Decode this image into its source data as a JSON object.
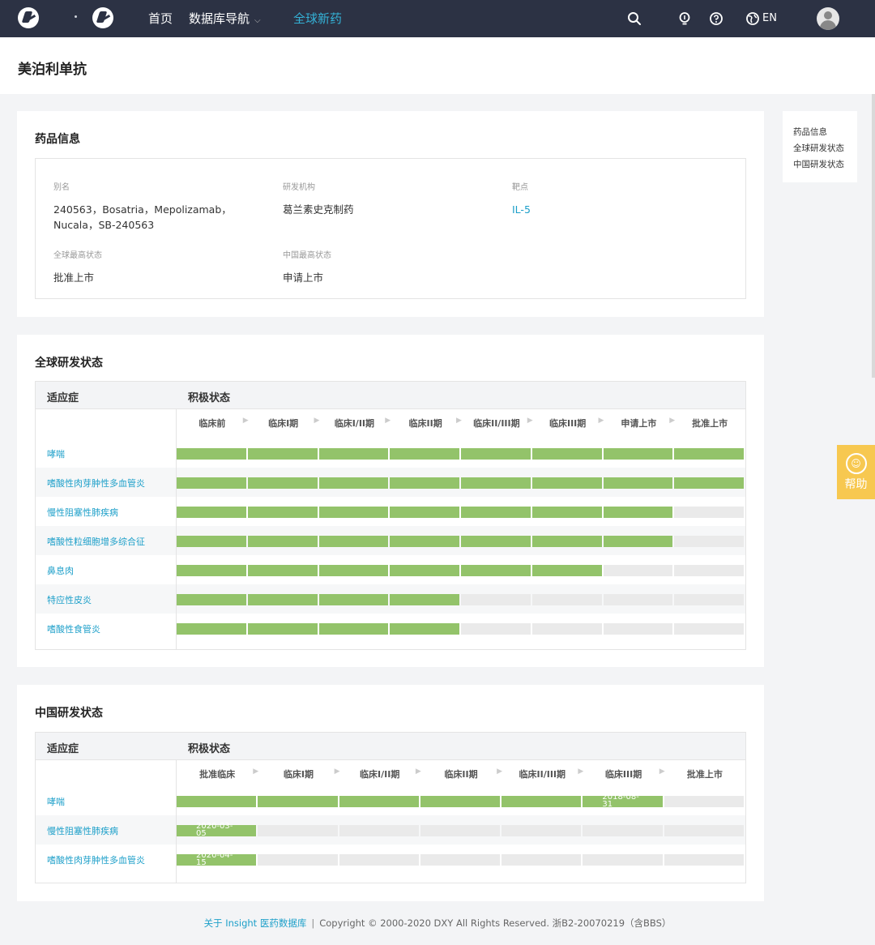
{
  "nav": {
    "home": "首页",
    "db_nav": "数据库导航",
    "global_new_drugs": "全球新药",
    "lang": "EN"
  },
  "page": {
    "title": "美泊利单抗"
  },
  "drug_info": {
    "title": "药品信息",
    "alias_label": "别名",
    "alias_value": "240563，Bosatria，Mepolizamab，Nucala，SB-240563",
    "org_label": "研发机构",
    "org_value": "葛兰素史克制药",
    "target_label": "靶点",
    "target_value": "IL-5",
    "global_status_label": "全球最高状态",
    "global_status_value": "批准上市",
    "china_status_label": "中国最高状态",
    "china_status_value": "申请上市"
  },
  "side_menu": {
    "items": [
      "药品信息",
      "全球研发状态",
      "中国研发状态"
    ]
  },
  "help": {
    "label": "帮助"
  },
  "global_status": {
    "title": "全球研发状态",
    "col_indication": "适应症",
    "col_status": "积极状态",
    "stages": [
      "临床前",
      "临床I期",
      "临床I/II期",
      "临床II期",
      "临床II/III期",
      "临床III期",
      "申请上市",
      "批准上市"
    ],
    "rows": [
      {
        "label": "哮喘",
        "filled": 8
      },
      {
        "label": "嗜酸性肉芽肿性多血管炎",
        "filled": 8
      },
      {
        "label": "慢性阻塞性肺疾病",
        "filled": 7
      },
      {
        "label": "嗜酸性粒细胞增多综合征",
        "filled": 7
      },
      {
        "label": "鼻息肉",
        "filled": 6
      },
      {
        "label": "特应性皮炎",
        "filled": 4
      },
      {
        "label": "嗜酸性食管炎",
        "filled": 4
      }
    ]
  },
  "china_status": {
    "title": "中国研发状态",
    "col_indication": "适应症",
    "col_status": "积极状态",
    "stages": [
      "批准临床",
      "临床I期",
      "临床I/II期",
      "临床II期",
      "临床II/III期",
      "临床III期",
      "批准上市"
    ],
    "rows": [
      {
        "label": "哮喘",
        "filled": 6,
        "date": "2018-08-31"
      },
      {
        "label": "慢性阻塞性肺疾病",
        "filled": 1,
        "date": "2020-03-05"
      },
      {
        "label": "嗜酸性肉芽肿性多血管炎",
        "filled": 1,
        "date": "2020-04-15"
      }
    ]
  },
  "footer": {
    "about": "关于 Insight 医药数据库",
    "separator": "|",
    "copyright": "Copyright © 2000-2020 DXY All Rights Reserved. 浙B2-20070219（含BBS）"
  }
}
